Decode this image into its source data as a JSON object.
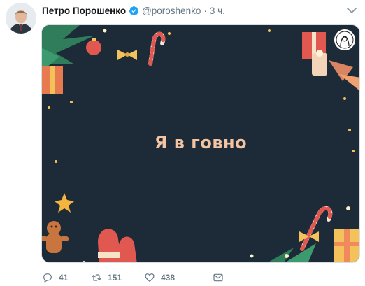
{
  "tweet": {
    "author_name": "Петро Порошенко",
    "author_handle": "@poroshenko",
    "separator": "·",
    "timestamp": "3 ч.",
    "image_text": "Я в говно",
    "counts": {
      "replies": "41",
      "retweets": "151",
      "likes": "438"
    }
  },
  "icons": {
    "avatar": "avatar-photo",
    "verified": "verified-badge-icon",
    "caret": "chevron-down-icon",
    "reply": "reply-icon",
    "retweet": "retweet-icon",
    "like": "heart-icon",
    "message": "direct-message-icon"
  },
  "colors": {
    "verified": "#1da1f2",
    "muted": "#657786",
    "card_bg": "#1c2b37",
    "card_text": "#f3c3a2"
  }
}
